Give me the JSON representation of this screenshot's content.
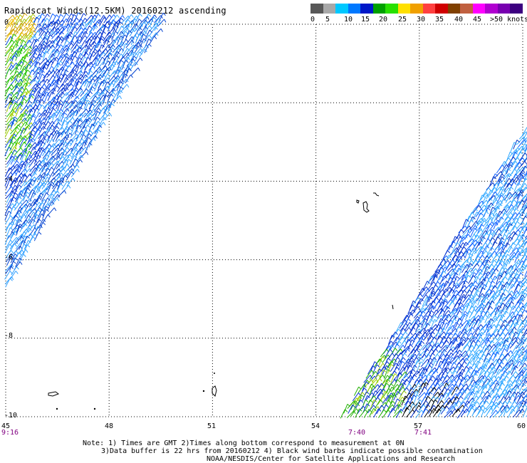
{
  "title": "Rapidscat Winds(12.5KM) 20160212 ascending",
  "legend": {
    "colors": [
      "#585858",
      "#a8a8a8",
      "#00c8ff",
      "#0078ff",
      "#0018c8",
      "#00a000",
      "#28e000",
      "#ffe000",
      "#f0a000",
      "#ff4040",
      "#d00000",
      "#804000",
      "#c06040",
      "#ff00ff",
      "#b000d0",
      "#7800b0",
      "#3c0080"
    ],
    "labels": [
      "0",
      "5",
      "10",
      "15",
      "20",
      "25",
      "30",
      "35",
      "40",
      "45",
      ">50 knots"
    ],
    "label_offsets": [
      0,
      21,
      47,
      71,
      96,
      123,
      149,
      175,
      202,
      228,
      252
    ]
  },
  "map": {
    "lon_ticks": [
      "45",
      "48",
      "51",
      "54",
      "57",
      "60"
    ],
    "lat_ticks": [
      "0",
      "-2",
      "-4",
      "-6",
      "-8",
      "-10"
    ],
    "time_labels": [
      "9:16",
      "7:40",
      "7:41"
    ],
    "lon_range": [
      45,
      60
    ],
    "lat_range": [
      0,
      -10
    ]
  },
  "notes": {
    "line1": "Note: 1) Times are GMT 2)Times along bottom correspond to measurement at 0N",
    "line2": "3)Data buffer is 22 hrs from 20160212 4) Black wind barbs indicate possible contamination",
    "line3": "NOAA/NESDIS/Center for Satellite Applications and Research"
  }
}
